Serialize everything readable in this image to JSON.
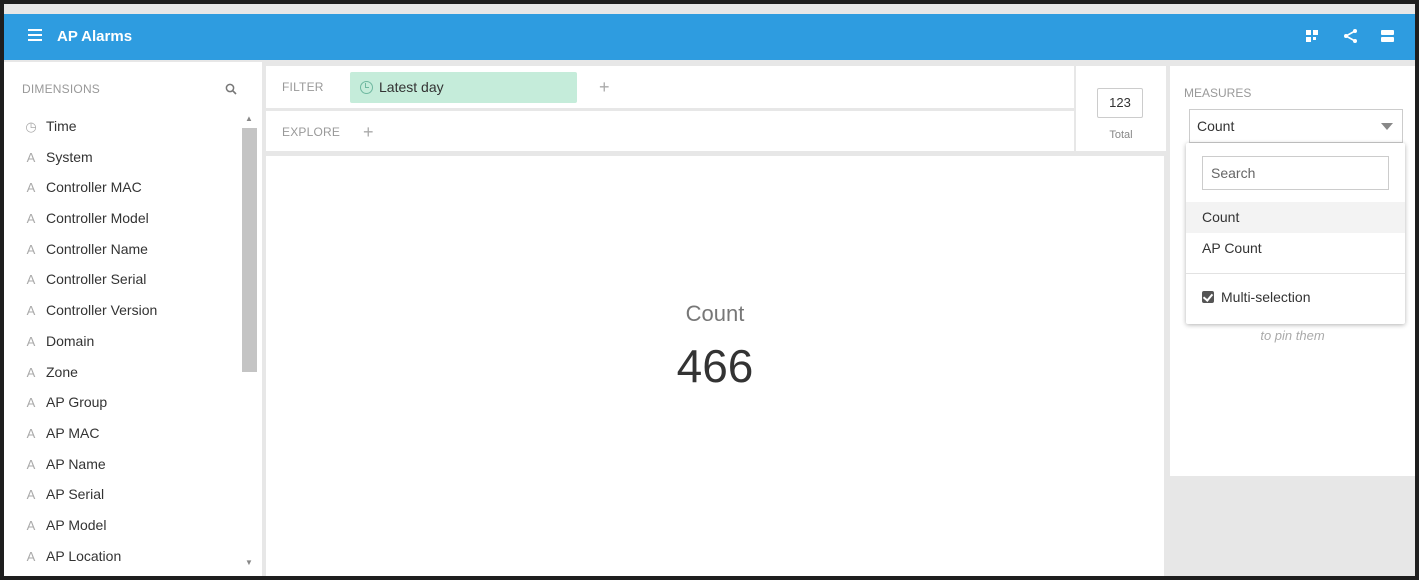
{
  "header": {
    "title": "AP Alarms"
  },
  "dimensions": {
    "heading": "DIMENSIONS",
    "items": [
      {
        "label": "Time",
        "icon": "clock-icon"
      },
      {
        "label": "System",
        "icon": "string-icon"
      },
      {
        "label": "Controller MAC",
        "icon": "string-icon"
      },
      {
        "label": "Controller Model",
        "icon": "string-icon"
      },
      {
        "label": "Controller Name",
        "icon": "string-icon"
      },
      {
        "label": "Controller Serial",
        "icon": "string-icon"
      },
      {
        "label": "Controller Version",
        "icon": "string-icon"
      },
      {
        "label": "Domain",
        "icon": "string-icon"
      },
      {
        "label": "Zone",
        "icon": "string-icon"
      },
      {
        "label": "AP Group",
        "icon": "string-icon"
      },
      {
        "label": "AP MAC",
        "icon": "string-icon"
      },
      {
        "label": "AP Name",
        "icon": "string-icon"
      },
      {
        "label": "AP Serial",
        "icon": "string-icon"
      },
      {
        "label": "AP Model",
        "icon": "string-icon"
      },
      {
        "label": "AP Location",
        "icon": "string-icon"
      }
    ]
  },
  "filter": {
    "label": "FILTER",
    "pill": "Latest day"
  },
  "explore": {
    "label": "EXPLORE"
  },
  "total": {
    "value": "123",
    "label": "Total"
  },
  "visualization": {
    "measure": "Count",
    "value": "466"
  },
  "measures": {
    "heading": "MEASURES",
    "selected": "Count",
    "hint": "to pin them",
    "dropdown": {
      "search_placeholder": "Search",
      "options": [
        "Count",
        "AP Count"
      ],
      "multi_selection": "Multi-selection"
    }
  },
  "colors": {
    "header": "#2e9ce0",
    "filter_pill": "#c5ecda"
  }
}
